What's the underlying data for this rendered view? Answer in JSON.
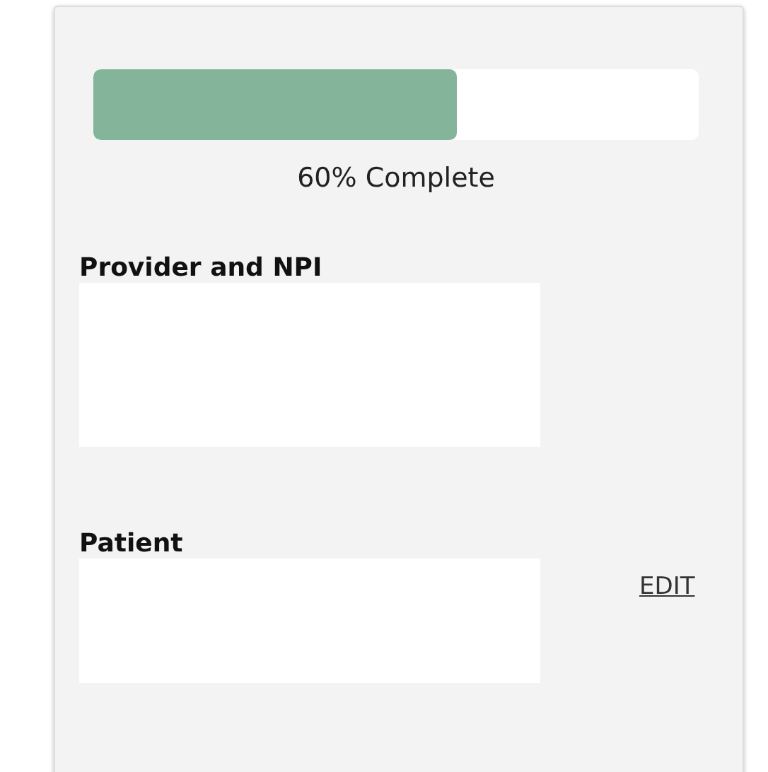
{
  "progress": {
    "level": 0.6,
    "label": "60% Complete"
  },
  "sections": [
    {
      "title": "Provider and NPI"
    },
    {
      "title": "Patient",
      "action": "EDIT"
    }
  ]
}
